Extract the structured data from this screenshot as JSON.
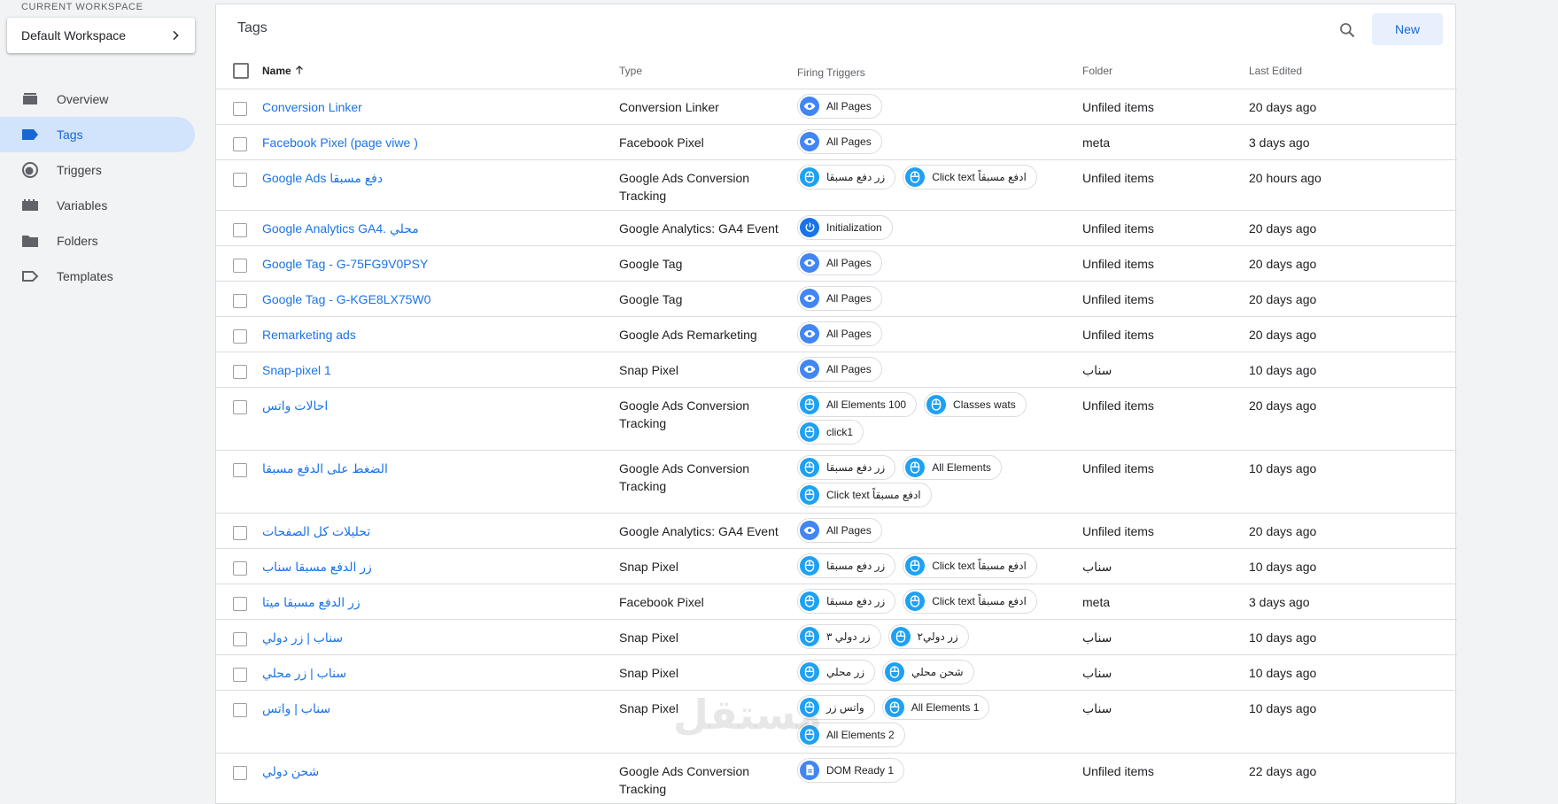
{
  "workspace": {
    "label": "CURRENT WORKSPACE",
    "name": "Default Workspace"
  },
  "nav": [
    {
      "label": "Overview",
      "icon": "overview-icon"
    },
    {
      "label": "Tags",
      "icon": "tag-icon",
      "active": true
    },
    {
      "label": "Triggers",
      "icon": "trigger-icon"
    },
    {
      "label": "Variables",
      "icon": "variables-icon"
    },
    {
      "label": "Folders",
      "icon": "folder-icon"
    },
    {
      "label": "Templates",
      "icon": "template-icon"
    }
  ],
  "card": {
    "title": "Tags",
    "new_label": "New"
  },
  "columns": {
    "name": "Name",
    "type": "Type",
    "triggers": "Firing Triggers",
    "folder": "Folder",
    "last_edited": "Last Edited"
  },
  "colors": {
    "accent": "#1967d2",
    "link": "#1a73e8",
    "active_nav": "#d2e3fc",
    "pageview_icon": "#4285f4",
    "click_icon": "#1ea1f2"
  },
  "rows": [
    {
      "name": "Conversion Linker",
      "type": "Conversion Linker",
      "triggers": [
        {
          "label": "All Pages",
          "icon": "pageview"
        }
      ],
      "folder": "Unfiled items",
      "edited": "20 days ago"
    },
    {
      "name": "Facebook Pixel (page viwe )",
      "type": "Facebook Pixel",
      "triggers": [
        {
          "label": "All Pages",
          "icon": "pageview"
        }
      ],
      "folder": "meta",
      "edited": "3 days ago"
    },
    {
      "name": "Google Ads دفع مسبقا",
      "type": "Google Ads Conversion Tracking",
      "triggers": [
        {
          "label": "زر دفع مسبقا",
          "icon": "click"
        },
        {
          "label": "Click text ادفع مسبقاً",
          "icon": "click"
        }
      ],
      "folder": "Unfiled items",
      "edited": "20 hours ago"
    },
    {
      "name": "Google Analytics GA4. محلي",
      "type": "Google Analytics: GA4 Event",
      "triggers": [
        {
          "label": "Initialization",
          "icon": "init"
        }
      ],
      "folder": "Unfiled items",
      "edited": "20 days ago"
    },
    {
      "name": "Google Tag - G-75FG9V0PSY",
      "type": "Google Tag",
      "triggers": [
        {
          "label": "All Pages",
          "icon": "pageview"
        }
      ],
      "folder": "Unfiled items",
      "edited": "20 days ago"
    },
    {
      "name": "Google Tag - G-KGE8LX75W0",
      "type": "Google Tag",
      "triggers": [
        {
          "label": "All Pages",
          "icon": "pageview"
        }
      ],
      "folder": "Unfiled items",
      "edited": "20 days ago"
    },
    {
      "name": "Remarketing ads",
      "type": "Google Ads Remarketing",
      "triggers": [
        {
          "label": "All Pages",
          "icon": "pageview"
        }
      ],
      "folder": "Unfiled items",
      "edited": "20 days ago"
    },
    {
      "name": "Snap-pixel 1",
      "type": "Snap Pixel",
      "triggers": [
        {
          "label": "All Pages",
          "icon": "pageview"
        }
      ],
      "folder": "سناب",
      "edited": "10 days ago"
    },
    {
      "name": "احالات واتس",
      "type": "Google Ads Conversion Tracking",
      "triggers": [
        {
          "label": "All Elements 100",
          "icon": "click"
        },
        {
          "label": "Classes wats",
          "icon": "click"
        },
        {
          "label": "click1",
          "icon": "click"
        }
      ],
      "folder": "Unfiled items",
      "edited": "20 days ago"
    },
    {
      "name": "الضغط على الدفع مسبقا",
      "type": "Google Ads Conversion Tracking",
      "triggers": [
        {
          "label": "زر دفع مسبقا",
          "icon": "click"
        },
        {
          "label": "All Elements",
          "icon": "click"
        },
        {
          "label": "Click text ادفع مسبقاً",
          "icon": "click"
        }
      ],
      "folder": "Unfiled items",
      "edited": "10 days ago"
    },
    {
      "name": "تحليلات كل الصفحات",
      "type": "Google Analytics: GA4 Event",
      "triggers": [
        {
          "label": "All Pages",
          "icon": "pageview"
        }
      ],
      "folder": "Unfiled items",
      "edited": "20 days ago"
    },
    {
      "name": "زر الدفع مسبقا سناب",
      "type": "Snap Pixel",
      "triggers": [
        {
          "label": "زر دفع مسبقا",
          "icon": "click"
        },
        {
          "label": "Click text ادفع مسبقاً",
          "icon": "click"
        }
      ],
      "folder": "سناب",
      "edited": "10 days ago"
    },
    {
      "name": "زر الدفع مسبقا ميتا",
      "type": "Facebook Pixel",
      "triggers": [
        {
          "label": "زر دفع مسبقا",
          "icon": "click"
        },
        {
          "label": "Click text ادفع مسبقاً",
          "icon": "click"
        }
      ],
      "folder": "meta",
      "edited": "3 days ago"
    },
    {
      "name": "سناب | زر دولي",
      "type": "Snap Pixel",
      "triggers": [
        {
          "label": "زر دولي ٣",
          "icon": "click"
        },
        {
          "label": "زر دولي٢",
          "icon": "click"
        }
      ],
      "folder": "سناب",
      "edited": "10 days ago"
    },
    {
      "name": "سناب | زر محلي",
      "type": "Snap Pixel",
      "triggers": [
        {
          "label": "زر محلي",
          "icon": "click"
        },
        {
          "label": "شحن محلي",
          "icon": "click"
        }
      ],
      "folder": "سناب",
      "edited": "10 days ago"
    },
    {
      "name": "سناب | واتس",
      "type": "Snap Pixel",
      "triggers": [
        {
          "label": "واتس زر",
          "icon": "click"
        },
        {
          "label": "All Elements 1",
          "icon": "click"
        },
        {
          "label": "All Elements 2",
          "icon": "click"
        }
      ],
      "folder": "سناب",
      "edited": "10 days ago"
    },
    {
      "name": "شحن دولي",
      "type": "Google Ads Conversion Tracking",
      "triggers": [
        {
          "label": "DOM Ready 1",
          "icon": "dom"
        }
      ],
      "folder": "Unfiled items",
      "edited": "22 days ago"
    }
  ],
  "watermark": "مستقل"
}
